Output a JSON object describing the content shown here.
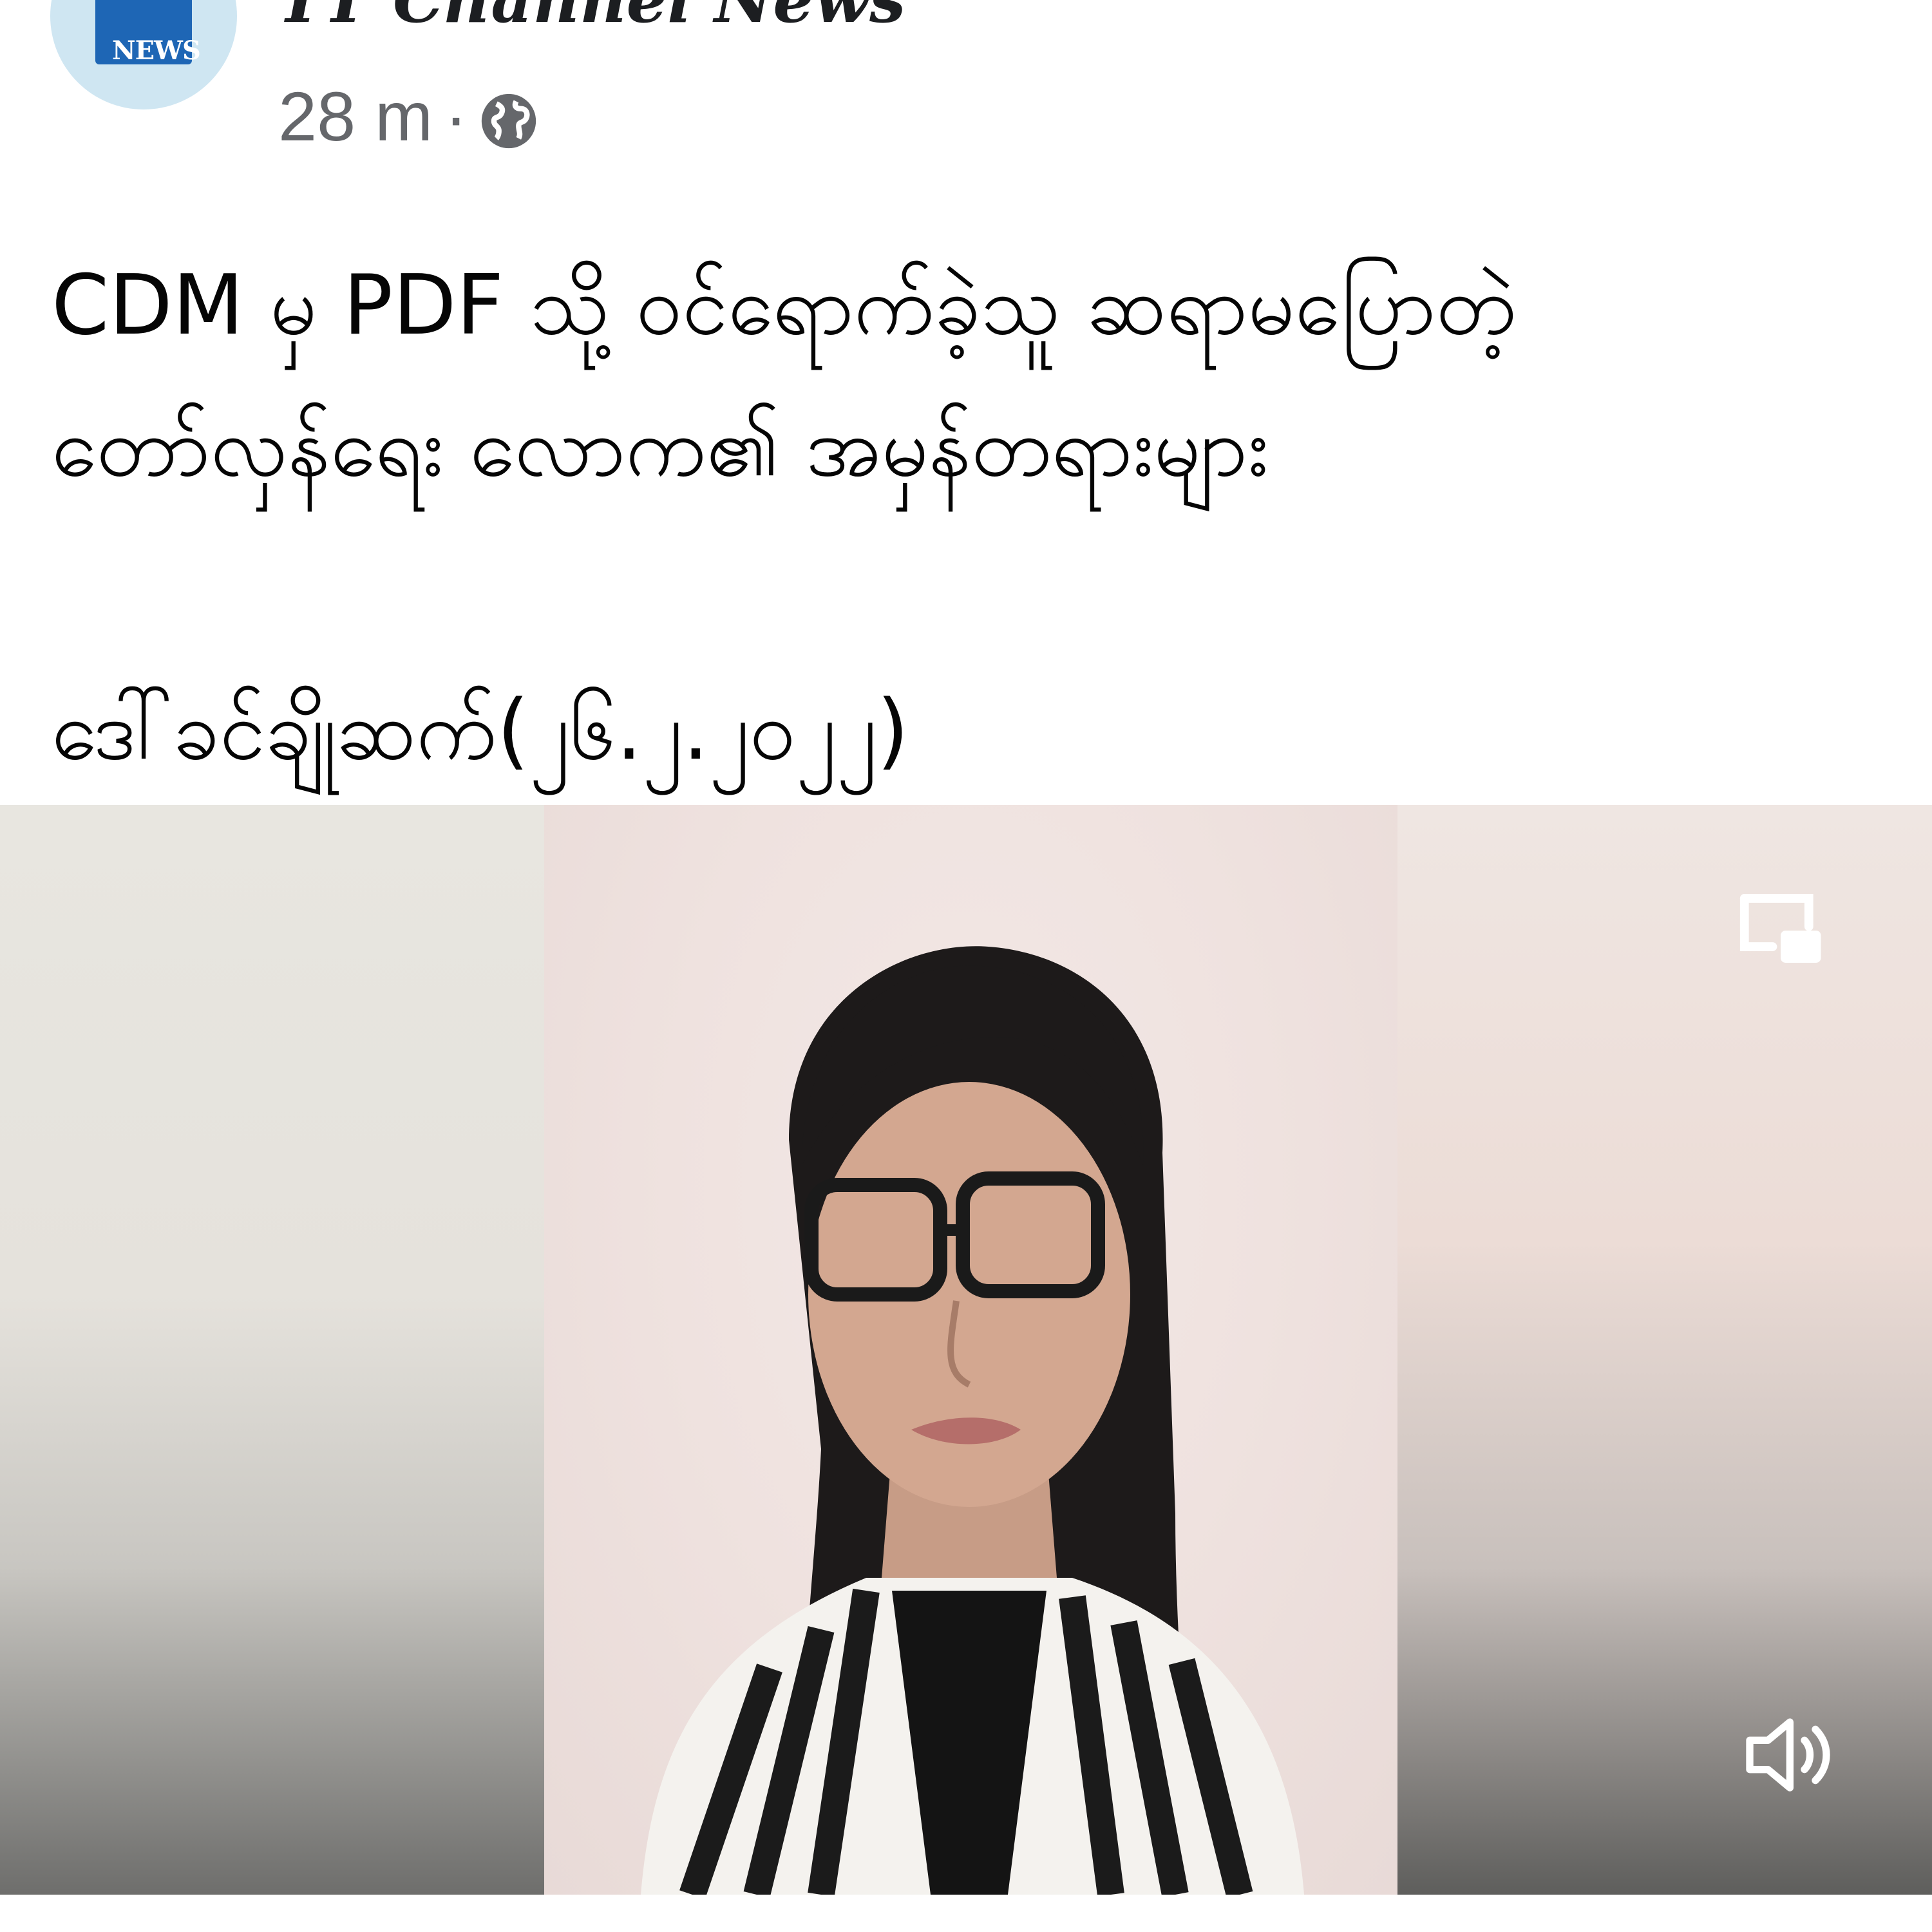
{
  "header": {
    "avatar_text": "NEWS",
    "channel_name": "TT Channel News",
    "time": "28 m",
    "separator": "·",
    "audience_icon": "globe-icon"
  },
  "caption": {
    "line1": "CDM မှ PDF သို့ ဝင်ရောက်ခဲ့သူ ဆရာမပြောတဲ့",
    "line2": "တော်လှန်ရေး လောက၏ အမှန်တရားများ",
    "line3": "ဒေါ်ခင်ချိုဆက်(၂၆.၂.၂၀၂၂)"
  },
  "video": {
    "pip_icon": "picture-in-picture-icon",
    "volume_icon": "volume-icon"
  },
  "colors": {
    "text": "#050505",
    "meta": "#65676b",
    "avatar_bg": "#1e66b5"
  }
}
